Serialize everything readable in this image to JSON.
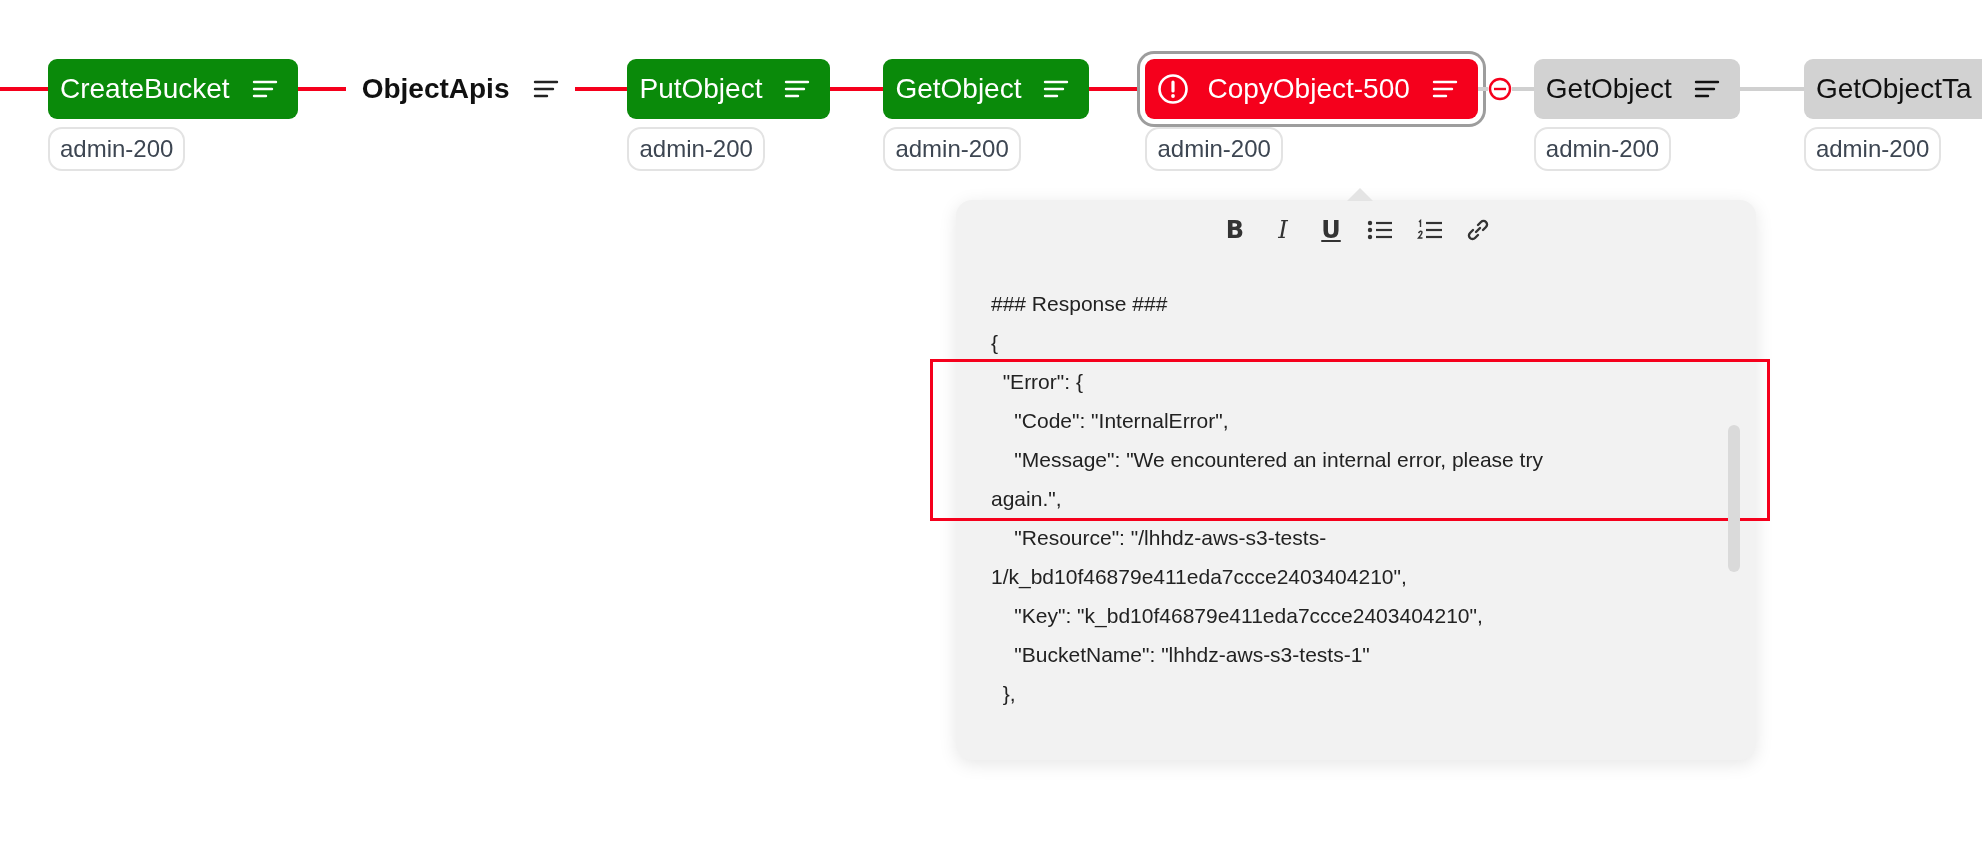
{
  "pipeline": {
    "steps": [
      {
        "kind": "passed",
        "label": "CreateBucket",
        "tag": "admin-200",
        "selected": false,
        "halted_before": false
      },
      {
        "kind": "group",
        "label": "ObjectApis"
      },
      {
        "kind": "passed",
        "label": "PutObject",
        "tag": "admin-200",
        "selected": false,
        "halted_before": false
      },
      {
        "kind": "passed",
        "label": "GetObject",
        "tag": "admin-200",
        "selected": false,
        "halted_before": false
      },
      {
        "kind": "failed",
        "label": "CopyObject-500",
        "tag": "admin-200",
        "selected": true,
        "halted_before": false
      },
      {
        "kind": "pending",
        "label": "GetObject",
        "tag": "admin-200",
        "selected": false,
        "halted_before": true
      },
      {
        "kind": "pending",
        "label": "GetObjectTa",
        "tag": "admin-200",
        "selected": false,
        "halted_before": false
      }
    ]
  },
  "note_popup": {
    "toolbar": [
      {
        "kind": "bold",
        "label": "B"
      },
      {
        "kind": "italic",
        "label": "I"
      },
      {
        "kind": "underline",
        "label": "U"
      },
      {
        "kind": "bullet-list"
      },
      {
        "kind": "numbered-list"
      },
      {
        "kind": "link"
      }
    ],
    "blocks": [
      {
        "highlighted": false,
        "lines": [
          "### Response ###",
          "{"
        ]
      },
      {
        "highlighted": true,
        "lines": [
          "  \"Error\": {",
          "    \"Code\": \"InternalError\",",
          "    \"Message\": \"We encountered an internal error, please try",
          "again.\","
        ]
      },
      {
        "highlighted": false,
        "lines": [
          "    \"Resource\": \"/lhhdz-aws-s3-tests-",
          "1/k_bd10f46879e411eda7ccce2403404210\",",
          "    \"Key\": \"k_bd10f46879e411eda7ccce2403404210\",",
          "    \"BucketName\": \"lhhdz-aws-s3-tests-1\"",
          "  },"
        ]
      }
    ]
  }
}
